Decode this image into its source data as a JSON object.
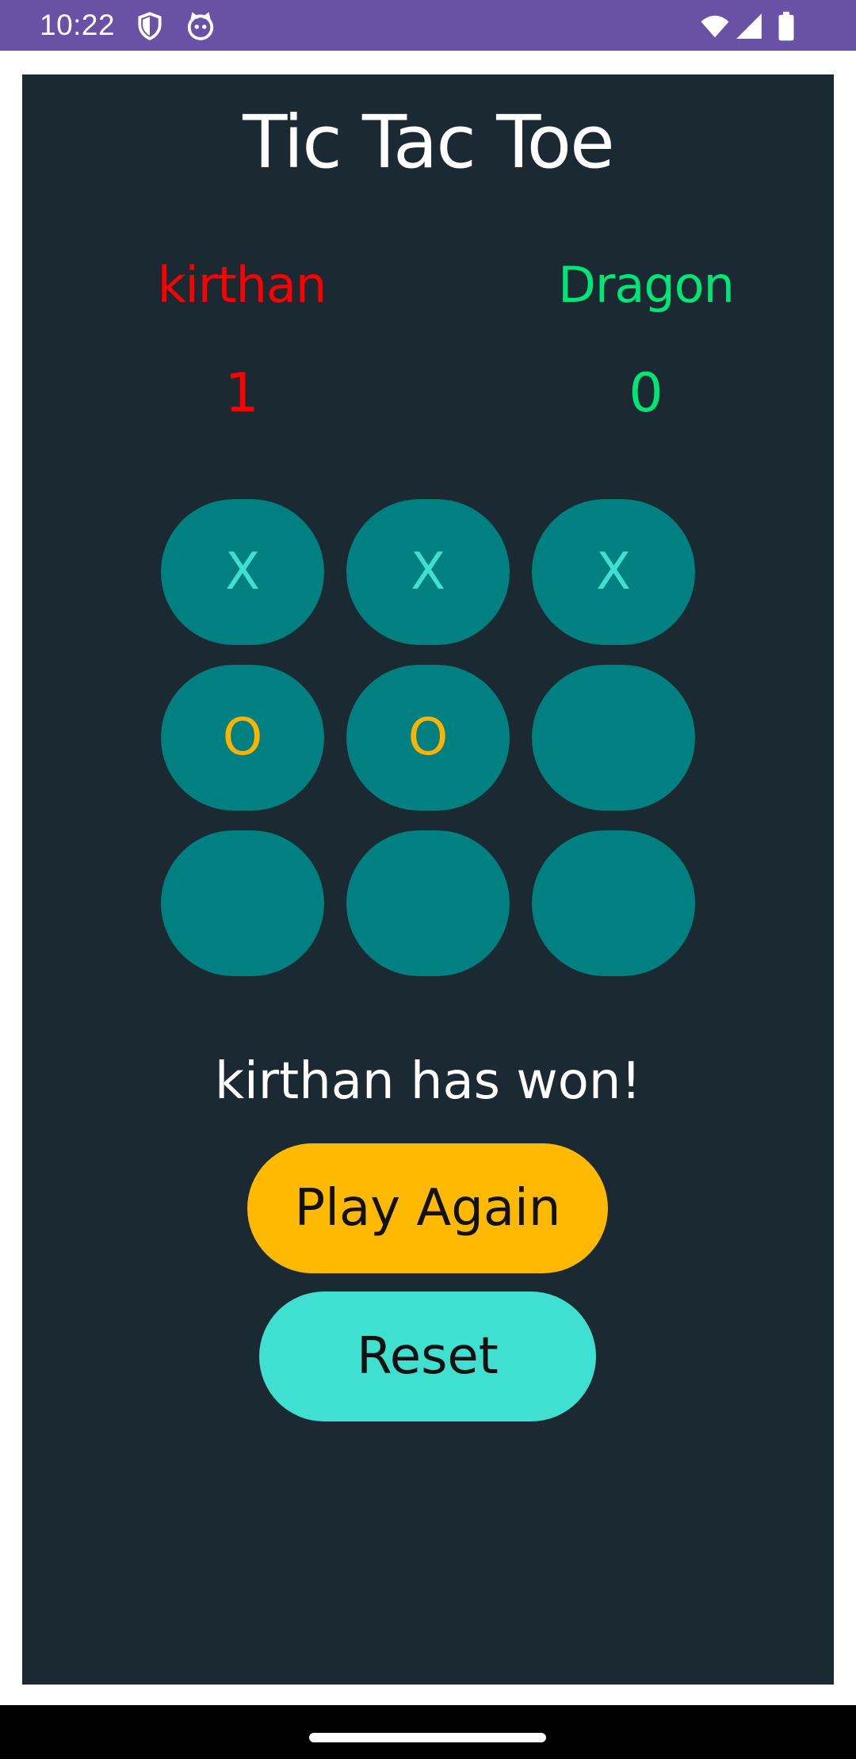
{
  "status_bar": {
    "time": "10:22",
    "icons": [
      "shield-icon",
      "cat-icon",
      "wifi-icon",
      "cellular-signal-icon",
      "battery-icon"
    ],
    "background": "#6952a6"
  },
  "app": {
    "title": "Tic Tac Toe",
    "background": "#1b2a32"
  },
  "players": [
    {
      "name": "kirthan",
      "score": "1",
      "color": "#ff0000"
    },
    {
      "name": "Dragon",
      "score": "0",
      "color": "#00e676"
    }
  ],
  "board": {
    "cells": [
      "X",
      "X",
      "X",
      "O",
      "O",
      "",
      "",
      "",
      ""
    ],
    "cell_color": "#008080",
    "x_color": "#40e0d0",
    "o_color": "#ffb300"
  },
  "message": "kirthan has won!",
  "buttons": {
    "play_again": "Play Again",
    "reset": "Reset",
    "play_again_color": "#ffb900",
    "reset_color": "#40e0d0"
  }
}
